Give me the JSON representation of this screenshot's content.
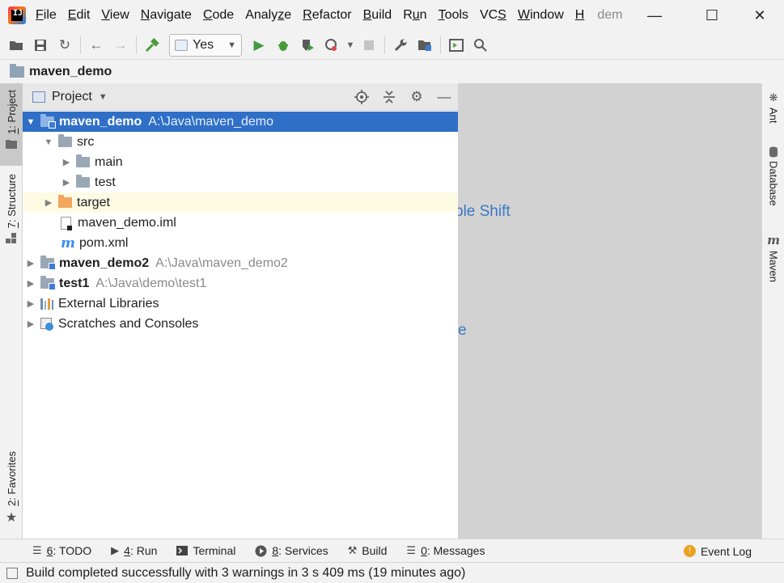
{
  "app": {
    "title_suffix": "dem",
    "icon_name": "intellij-idea-icon"
  },
  "menu": [
    {
      "pre": "",
      "ul": "F",
      "post": "ile"
    },
    {
      "pre": "",
      "ul": "E",
      "post": "dit"
    },
    {
      "pre": "",
      "ul": "V",
      "post": "iew"
    },
    {
      "pre": "",
      "ul": "N",
      "post": "avigate"
    },
    {
      "pre": "",
      "ul": "C",
      "post": "ode"
    },
    {
      "pre": "Analy",
      "ul": "z",
      "post": "e"
    },
    {
      "pre": "",
      "ul": "R",
      "post": "efactor"
    },
    {
      "pre": "",
      "ul": "B",
      "post": "uild"
    },
    {
      "pre": "R",
      "ul": "u",
      "post": "n"
    },
    {
      "pre": "",
      "ul": "T",
      "post": "ools"
    },
    {
      "pre": "VC",
      "ul": "S",
      "post": ""
    },
    {
      "pre": "",
      "ul": "W",
      "post": "indow"
    },
    {
      "pre": "",
      "ul": "H",
      "post": ""
    }
  ],
  "toolbar": {
    "run_config": "Yes"
  },
  "breadcrumb": {
    "project": "maven_demo"
  },
  "left_tabs": {
    "project": {
      "num": "1",
      "label": ": Project"
    },
    "structure": {
      "num": "7",
      "label": ": Structure"
    },
    "favorites": {
      "num": "2",
      "label": ": Favorites"
    }
  },
  "right_tabs": {
    "ant": "Ant",
    "database": "Database",
    "maven": "Maven"
  },
  "project_panel": {
    "title": "Project"
  },
  "tree": {
    "maven_demo": {
      "name": "maven_demo",
      "path": "A:\\Java\\maven_demo"
    },
    "src": "src",
    "main": "main",
    "test": "test",
    "target": "target",
    "iml": "maven_demo.iml",
    "pom": "pom.xml",
    "maven_demo2": {
      "name": "maven_demo2",
      "path": "A:\\Java\\maven_demo2"
    },
    "test1": {
      "name": "test1",
      "path": "A:\\Java\\demo\\test1"
    },
    "external_libraries": "External Libraries",
    "scratches": "Scratches and Consoles"
  },
  "editor": {
    "hint1": "ble Shift",
    "hint2": "e"
  },
  "bottom_tools": {
    "todo": {
      "num": "6",
      "label": ": TODO"
    },
    "run": {
      "num": "4",
      "label": ": Run"
    },
    "terminal": "Terminal",
    "services": {
      "num": "8",
      "label": ": Services"
    },
    "build": "Build",
    "messages": {
      "num": "0",
      "label": ": Messages"
    },
    "event_log": "Event Log"
  },
  "status": {
    "message": "Build completed successfully with 3 warnings in 3 s 409 ms (19 minutes ago)"
  }
}
